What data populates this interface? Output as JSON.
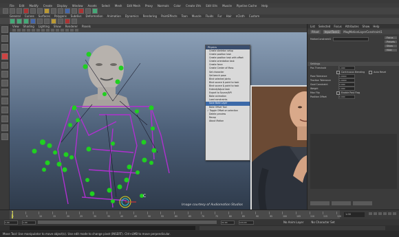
{
  "menubar": {
    "items": [
      "File",
      "Edit",
      "Modify",
      "Create",
      "Display",
      "Window",
      "Assets",
      "Select",
      "Mesh",
      "Edit Mesh",
      "Proxy",
      "Normals",
      "Color",
      "Create UVs",
      "Edit UVs",
      "Muscle",
      "Pipeline Cache",
      "Help"
    ]
  },
  "shelf": {
    "tabs": [
      "General",
      "Curves",
      "Surfaces",
      "Polygons",
      "Subdivs",
      "Deformation",
      "Animation",
      "Dynamics",
      "Rendering",
      "PaintEffects",
      "Toon",
      "Muscle",
      "Fluids",
      "Fur",
      "Hair",
      "nCloth",
      "Custom"
    ]
  },
  "viewport": {
    "menu": [
      "View",
      "Shading",
      "Lighting",
      "Show",
      "Renderer",
      "Panels"
    ],
    "credit": "Image courtesy of Audiomotion Studios",
    "marker_label": "C"
  },
  "popup": {
    "title": "Physics",
    "items": [
      {
        "label": "Create skeleton setup",
        "state": ""
      },
      {
        "label": "Create position task",
        "state": ""
      },
      {
        "label": "Create position task with offset",
        "state": ""
      },
      {
        "label": "Create orientation task",
        "state": ""
      },
      {
        "label": "Create force",
        "state": ""
      },
      {
        "label": "Create Center of Mass",
        "state": ""
      },
      {
        "label": "Set character",
        "state": ""
      },
      {
        "label": "Set bench pose",
        "state": ""
      },
      {
        "label": "Bind selected joints",
        "state": ""
      },
      {
        "label": "Bind source & point to task",
        "state": ""
      },
      {
        "label": "Bind source & point to task",
        "state": ""
      },
      {
        "label": "Extend/Adjust task",
        "state": ""
      },
      {
        "label": "Export to Source/API",
        "state": ""
      },
      {
        "label": "Bake animation",
        "state": ""
      },
      {
        "label": "Load constraints",
        "state": ""
      },
      {
        "label": "Save Bake Layer",
        "state": "highlight"
      },
      {
        "label": "Bake Offset Tool",
        "state": ""
      },
      {
        "label": "Toggle Offset on selection",
        "state": "check"
      },
      {
        "label": "Delete preview",
        "state": ""
      },
      {
        "label": "Recap",
        "state": ""
      },
      {
        "label": "About Motion",
        "state": ""
      }
    ]
  },
  "attribute_editor": {
    "tabs": [
      "List",
      "Selected",
      "Focus",
      "Attributes",
      "Show",
      "Help"
    ],
    "node_tabs": [
      "Rfoot",
      "InputTask1",
      "MagMotionLayerConstraint1"
    ],
    "name_label": "MotionConstraint1",
    "buttons": [
      "Focus",
      "Presets",
      "Show",
      "Hide"
    ],
    "section": "Settings",
    "rows": [
      {
        "label": "Pos Threshold",
        "value": "1.000"
      },
      {
        "label": "",
        "value": "Continuous Blending"
      },
      {
        "label": "Pose Tolerance",
        "value": "1.0000"
      },
      {
        "label": "Traction Tolerance",
        "value": "1.0000"
      },
      {
        "label": "Goal Constraint",
        "value": "0.000"
      },
      {
        "label": "Weight",
        "value": "1.000"
      },
      {
        "label": "Max Flip",
        "value": ""
      },
      {
        "label": "Position Offset",
        "value": "0.000"
      }
    ],
    "checkbox_label": "Auto Reset",
    "checkbox2_label": "Enable Post Flag"
  },
  "timeline": {
    "ticks": [
      "1",
      "5",
      "10",
      "15",
      "20",
      "25",
      "30",
      "35",
      "40",
      "45",
      "50",
      "55",
      "60",
      "65",
      "70",
      "75",
      "80",
      "85",
      "90",
      "95",
      "100",
      "105",
      "110",
      "115",
      "120"
    ],
    "current_frame": "1.00"
  },
  "range": {
    "start": "1.00",
    "end": "32.00",
    "range_end": "120.00",
    "anim_layer": "No Anim Layer",
    "character": "No Character Set"
  },
  "help": {
    "text": "Move Tool: Use manipulator to move object(s). Use edit mode to change pivot (INSERT). Ctrl+LMB to move perpendicular."
  },
  "colors": {
    "popup_highlight": "#3b69a8",
    "joint_green": "#20d020",
    "rig_purple": "#b030d0"
  }
}
